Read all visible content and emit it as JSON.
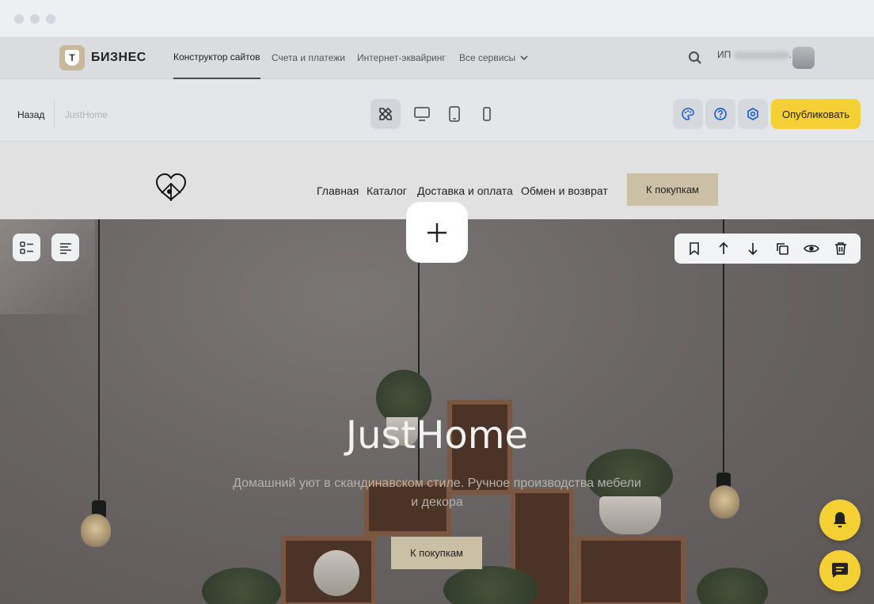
{
  "topbar": {
    "brand": "БИЗНЕС",
    "nav": [
      {
        "label": "Конструктор сайтов",
        "active": true
      },
      {
        "label": "Счета и платежи"
      },
      {
        "label": "Интернет-эквайринг"
      },
      {
        "label": "Все сервисы"
      }
    ],
    "user_prefix": "ИП",
    "user_suffix": "."
  },
  "toolbar": {
    "back_label": "Назад",
    "site_name": "JustHome",
    "publish_label": "Опубликовать"
  },
  "site": {
    "nav": [
      "Главная",
      "Каталог",
      "Доставка и оплата",
      "Обмен и возврат"
    ],
    "shop_button": "К покупкам"
  },
  "hero": {
    "title": "JustHome",
    "subtitle": "Домашний уют в скандинавском стиле. Ручное производства мебели и декора",
    "button": "К покупкам"
  },
  "colors": {
    "accent": "#f5d034",
    "brand_beige": "#cbc0a6"
  }
}
